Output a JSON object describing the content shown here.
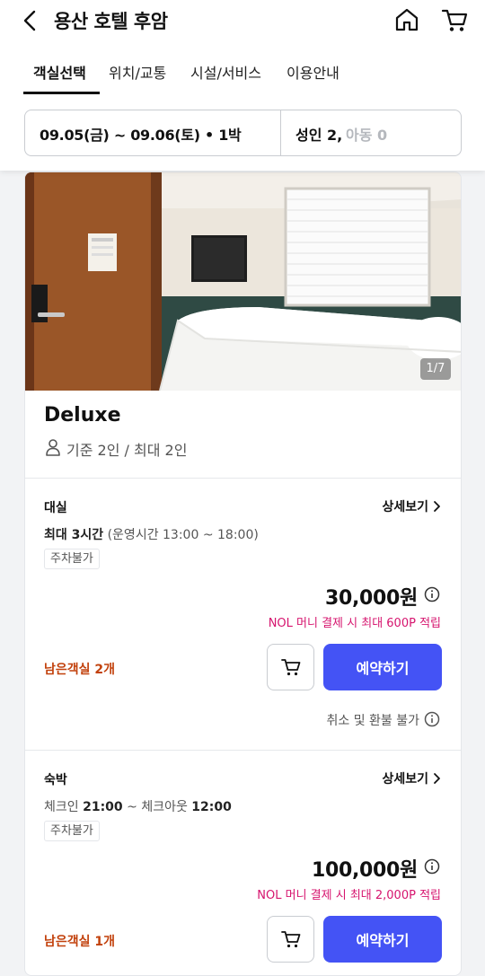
{
  "header": {
    "title": "용산 호텔 후암",
    "tabs": [
      "객실선택",
      "위치/교통",
      "시설/서비스",
      "이용안내"
    ]
  },
  "filter": {
    "dates": "09.05(금) ~ 09.06(토) • 1박",
    "adult": "성인 2,",
    "child": "아동 0"
  },
  "room": {
    "photo_counter": "1/7",
    "name": "Deluxe",
    "capacity": "기준 2인 / 최대 2인"
  },
  "options": [
    {
      "type": "대실",
      "detail_label": "상세보기",
      "info_prefix": "최대 3시간",
      "info_rest": "(운영시간 13:00 ~ 18:00)",
      "badge": "주차불가",
      "price": "30,000원",
      "nol": "NOL 머니 결제 시 최대 600P 적립",
      "remaining": "남은객실 2개",
      "reserve_label": "예약하기",
      "refund": "취소 및 환불 불가"
    },
    {
      "type": "숙박",
      "detail_label": "상세보기",
      "checkin_label": "체크인",
      "checkin_time": "21:00",
      "tilde": "~",
      "checkout_label": "체크아웃",
      "checkout_time": "12:00",
      "badge": "주차불가",
      "price": "100,000원",
      "nol": "NOL 머니 결제 시 최대 2,000P 적립",
      "remaining": "남은객실 1개",
      "reserve_label": "예약하기"
    }
  ],
  "colors": {
    "accent": "#4453f5",
    "remaining": "#c2410c",
    "point": "#d6146e"
  }
}
